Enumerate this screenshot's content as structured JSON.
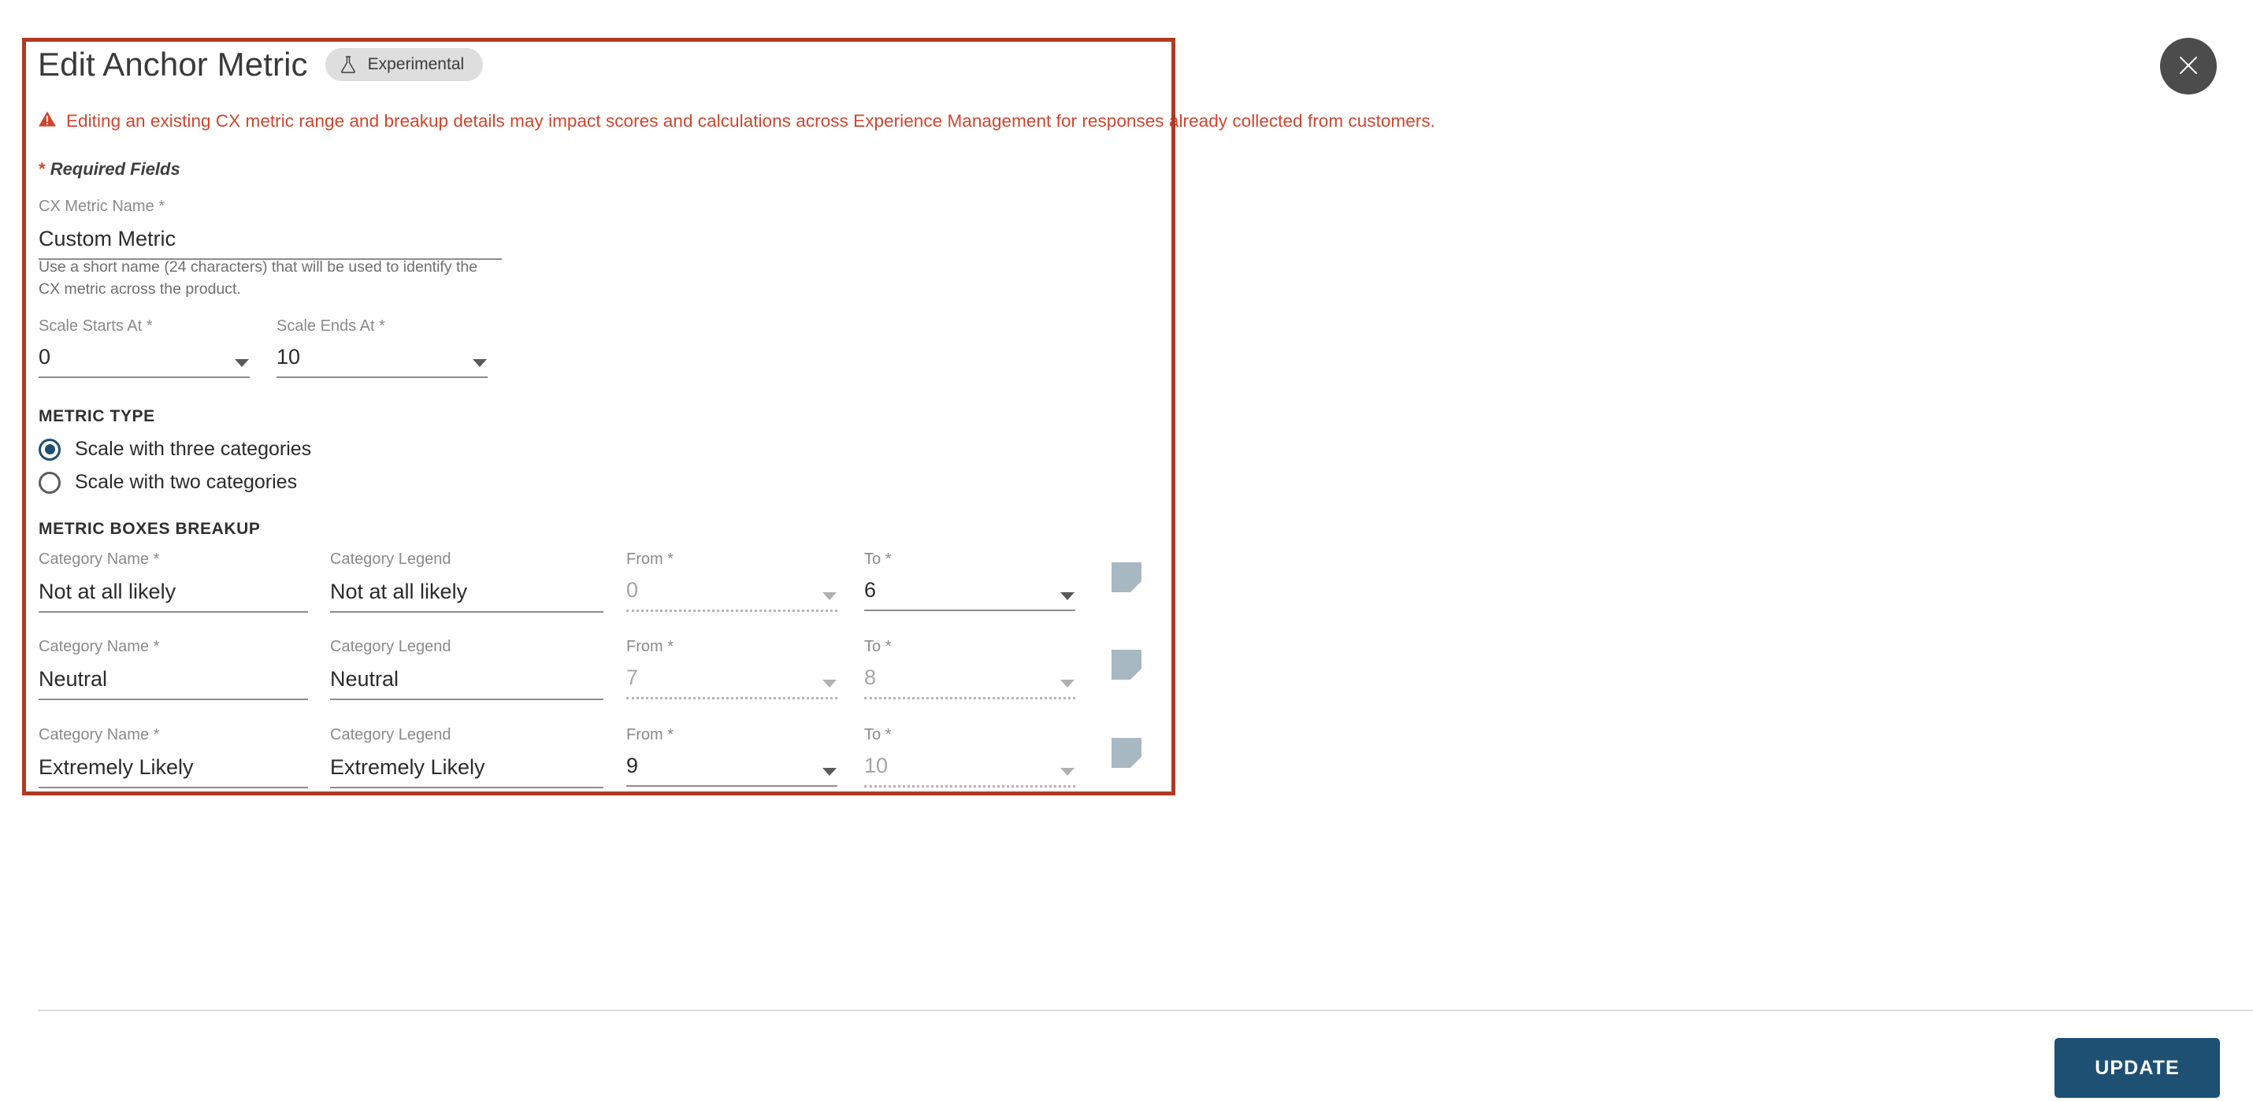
{
  "dialog": {
    "title": "Edit Anchor Metric",
    "badge": {
      "label": "Experimental",
      "icon": "flask-icon"
    },
    "close_icon": "close-icon",
    "warning": {
      "icon": "warning-triangle-icon",
      "text": "Editing an existing CX metric range and breakup details may impact scores and calculations across Experience Management for responses already collected from customers.",
      "color": "#cf4630"
    },
    "required_fields_note": "Required Fields",
    "required_star": "*"
  },
  "cx_metric_name": {
    "label": "CX Metric Name *",
    "value": "Custom Metric",
    "placeholder": "CX Metric Name",
    "help": "Use a short name (24 characters) that will be used to identify the CX metric across the product."
  },
  "scale": {
    "starts": {
      "label": "Scale Starts At *",
      "value": "0"
    },
    "ends": {
      "label": "Scale Ends At *",
      "value": "10"
    }
  },
  "metric_type": {
    "heading": "METRIC TYPE",
    "selected": "three",
    "options": [
      {
        "id": "three",
        "label": "Scale with three categories",
        "selected": true
      },
      {
        "id": "two",
        "label": "Scale with two categories",
        "selected": false
      }
    ]
  },
  "breakup": {
    "heading": "METRIC BOXES BREAKUP",
    "columns": {
      "name": "Category Name *",
      "legend": "Category Legend",
      "from": "From *",
      "to": "To *"
    },
    "rows": [
      {
        "name": "Not at all likely",
        "legend": "Not at all likely",
        "from": "0",
        "from_disabled": true,
        "to": "6",
        "to_disabled": false,
        "color": "#a8b8c2"
      },
      {
        "name": "Neutral",
        "legend": "Neutral",
        "from": "7",
        "from_disabled": true,
        "to": "8",
        "to_disabled": true,
        "color": "#a8b8c2"
      },
      {
        "name": "Extremely Likely",
        "legend": "Extremely Likely",
        "from": "9",
        "from_disabled": false,
        "to": "10",
        "to_disabled": true,
        "color": "#a8b8c2"
      }
    ]
  },
  "footer": {
    "update_label": "UPDATE",
    "accent_color": "#1d5073"
  }
}
